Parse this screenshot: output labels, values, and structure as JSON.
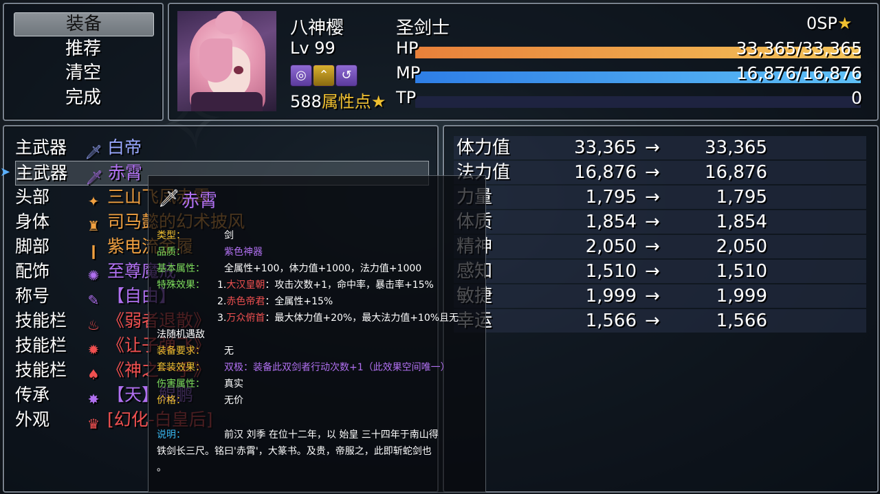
{
  "command_menu": {
    "items": [
      "装备",
      "推荐",
      "清空",
      "完成"
    ],
    "selected_index": 0
  },
  "actor": {
    "name": "八神樱",
    "class": "圣剑士",
    "level_label": "Lv 99",
    "sp": "0SP",
    "attribute_points": "588",
    "attribute_points_label": "属性点",
    "hp_label": "HP",
    "hp_value": "33,365/33,365",
    "hp_fraction": 1.0,
    "mp_label": "MP",
    "mp_value": "16,876/16,876",
    "mp_fraction": 1.0,
    "tp_label": "TP",
    "tp_value": "0",
    "tp_fraction": 0.0,
    "state_icons": [
      "target-state-icon",
      "rank-up-state-icon",
      "swirl-state-icon"
    ],
    "colors": {
      "hp": "#f0a040",
      "mp": "#40a0f0"
    }
  },
  "equip_slots": [
    {
      "slot": "主武器",
      "item": "白帝",
      "icon": "sword-icon",
      "color": "#9aa8ff"
    },
    {
      "slot": "主武器",
      "item": "赤霄",
      "icon": "red-sword-icon",
      "color": "#b070f0"
    },
    {
      "slot": "头部",
      "item": "三山飞凤赤霄",
      "icon": "helmet-icon",
      "color": "#f0a040"
    },
    {
      "slot": "身体",
      "item": "司马懿的幻术披风",
      "icon": "cloak-icon",
      "color": "#f0a040"
    },
    {
      "slot": "脚部",
      "item": "紫电流金履",
      "icon": "boots-icon",
      "color": "#f0a040"
    },
    {
      "slot": "配饰",
      "item": "至尊魔戒",
      "icon": "ring-icon",
      "color": "#b070f0"
    },
    {
      "slot": "称号",
      "item": "【自由】",
      "icon": "title-icon",
      "color": "#b070f0"
    },
    {
      "slot": "技能栏",
      "item": "《弱者退散》",
      "icon": "fire-skill-icon",
      "color": "#f05050"
    },
    {
      "slot": "技能栏",
      "item": "《让子弹飞》",
      "icon": "gear-skill-icon",
      "color": "#f05050"
    },
    {
      "slot": "技能栏",
      "item": "《神之一手》",
      "icon": "mushroom-skill-icon",
      "color": "#f05050"
    },
    {
      "slot": "传承",
      "item": "【天】鲲鹏",
      "icon": "inherit-icon",
      "color": "#b070f0"
    },
    {
      "slot": "外观",
      "item": "[幻化-白皇后]",
      "icon": "crown-icon",
      "color": "#f05050"
    }
  ],
  "selected_slot_index": 1,
  "params": [
    {
      "name": "体力值",
      "old": "33,365",
      "new": "33,365"
    },
    {
      "name": "法力值",
      "old": "16,876",
      "new": "16,876"
    },
    {
      "name": "力量",
      "old": "1,795",
      "new": "1,795"
    },
    {
      "name": "体质",
      "old": "1,854",
      "new": "1,854"
    },
    {
      "name": "精神",
      "old": "2,050",
      "new": "2,050"
    },
    {
      "name": "感知",
      "old": "1,510",
      "new": "1,510"
    },
    {
      "name": "敏捷",
      "old": "1,999",
      "new": "1,999"
    },
    {
      "name": "幸运",
      "old": "1,566",
      "new": "1,566"
    }
  ],
  "arrow": "→",
  "help": {
    "title": "赤霄",
    "type_label": "类型：",
    "type_value": "剑",
    "quality_label": "品质：",
    "quality_value": "紫色神器",
    "base_label": "基本属性：",
    "base_value": "全属性+100，体力值+1000，法力值+1000",
    "special_label": "特殊效果：",
    "special_1_num": "1.",
    "special_1_name": "大汉皇朝",
    "special_1_text": "：攻击次数+1，命中率，暴击率+15%",
    "special_2_num": "2.",
    "special_2_name": "赤色帝君",
    "special_2_text": "：全属性+15%",
    "special_3_num": "3.",
    "special_3_name": "万众俯首",
    "special_3_text": "：最大体力值+20%，最大法力值+10%且无",
    "special_3_cont": "法随机遇敌",
    "req_label": "装备要求：",
    "req_value": "无",
    "set_label": "套装效果：",
    "set_value": "双极：装备此双剑者行动次数+1（此效果空间唯一）",
    "dmg_label": "伤害属性：",
    "dmg_value": "真实",
    "price_label": "价格：",
    "price_value": "无价",
    "desc_label": "说明：",
    "desc_line1": "前汉 刘季 在位十二年，以 始皇 三十四年于南山得",
    "desc_line2": "铁剑长三尺。铭曰'赤霄'，大篆书。及贵，帝服之，此即斩蛇剑也",
    "desc_line3": "。"
  }
}
